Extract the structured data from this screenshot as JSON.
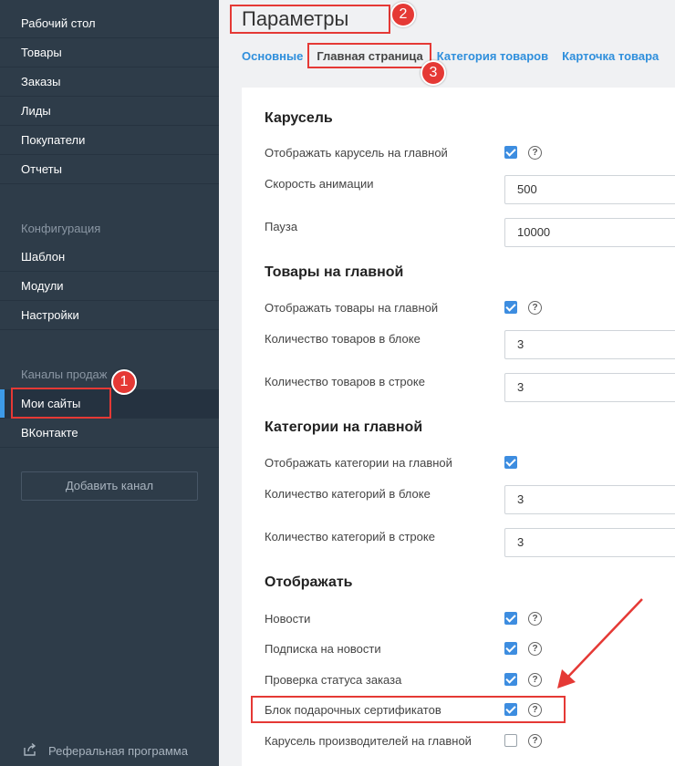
{
  "sidebar": {
    "items": [
      {
        "label": "Рабочий стол"
      },
      {
        "label": "Товары"
      },
      {
        "label": "Заказы"
      },
      {
        "label": "Лиды"
      },
      {
        "label": "Покупатели"
      },
      {
        "label": "Отчеты"
      }
    ],
    "config_section": "Конфигурация",
    "config_items": [
      {
        "label": "Шаблон"
      },
      {
        "label": "Модули"
      },
      {
        "label": "Настройки"
      }
    ],
    "channels_section": "Каналы продаж",
    "channel_items": [
      {
        "label": "Мои сайты"
      },
      {
        "label": "ВКонтакте"
      }
    ],
    "add_channel": "Добавить канал",
    "referral": "Реферальная программа"
  },
  "page": {
    "title": "Параметры",
    "tabs": [
      {
        "label": "Основные"
      },
      {
        "label": "Главная страница"
      },
      {
        "label": "Категория товаров"
      },
      {
        "label": "Карточка товара"
      }
    ]
  },
  "sections": {
    "carousel": {
      "title": "Карусель",
      "show_label": "Отображать карусель на главной",
      "speed_label": "Скорость анимации",
      "speed_value": "500",
      "pause_label": "Пауза",
      "pause_value": "10000"
    },
    "products": {
      "title": "Товары на главной",
      "show_label": "Отображать товары на главной",
      "per_block_label": "Количество товаров в блоке",
      "per_block_value": "3",
      "per_row_label": "Количество товаров в строке",
      "per_row_value": "3"
    },
    "categories": {
      "title": "Категории на главной",
      "show_label": "Отображать категории на главной",
      "per_block_label": "Количество категорий в блоке",
      "per_block_value": "3",
      "per_row_label": "Количество категорий в строке",
      "per_row_value": "3"
    },
    "display": {
      "title": "Отображать",
      "news_label": "Новости",
      "subscribe_label": "Подписка на новости",
      "order_status_label": "Проверка статуса заказа",
      "gift_cert_label": "Блок подарочных сертификатов",
      "brands_carousel_label": "Карусель производителей на главной"
    }
  },
  "help_glyph": "?",
  "annotations": {
    "badge1": "1",
    "badge2": "2",
    "badge3": "3"
  },
  "colors": {
    "sidebar_bg": "#2e3c49",
    "accent": "#3d9be9",
    "checkbox": "#3d8de0",
    "annotation": "#e53935"
  }
}
